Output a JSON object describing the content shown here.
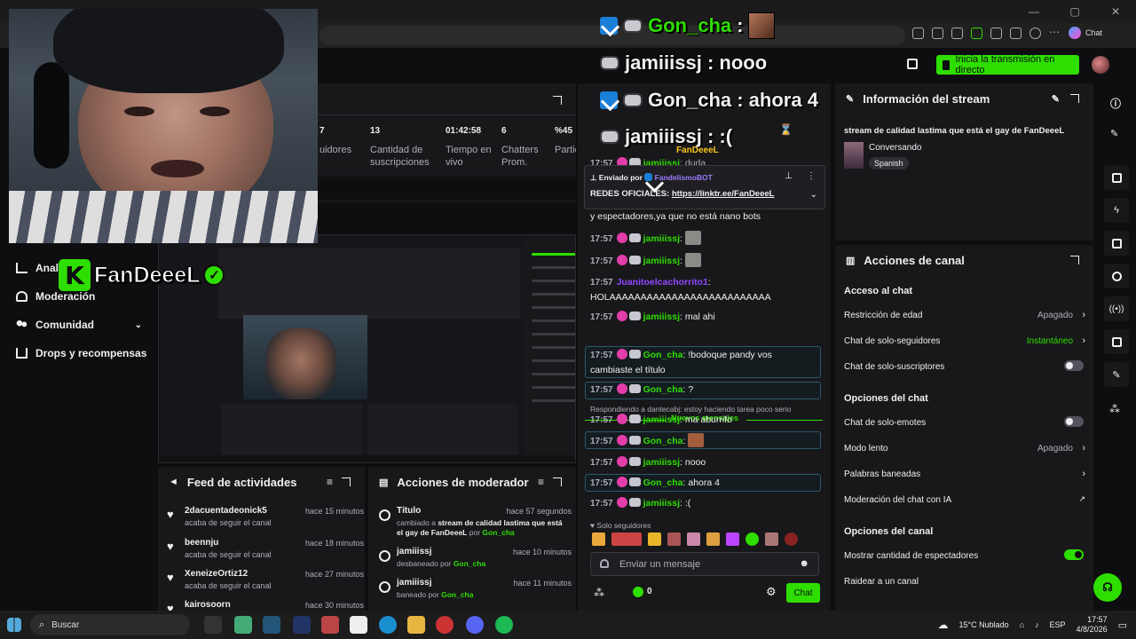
{
  "overlay": {
    "line1_user": "Gon_cha",
    "line1_sep": ":",
    "line2": "jamiiissj : nooo",
    "line3": "Gon_cha : ahora 4",
    "line4": "jamiiissj : :(",
    "line4_tag": "FanDeeeL"
  },
  "browser": {
    "chat_label": "Chat"
  },
  "topbar": {
    "go_live_label": "Inicia la transmisión en directo"
  },
  "nav": {
    "items": [
      {
        "label": "Anal"
      },
      {
        "label": "Moderación"
      },
      {
        "label": "Comunidad"
      },
      {
        "label": "Drops y recompensas"
      }
    ]
  },
  "logo": {
    "text": "FanDeeeL"
  },
  "stats": {
    "items": [
      {
        "value": "7",
        "label": "uidores"
      },
      {
        "value": "13",
        "label": "Cantidad de suscripciones"
      },
      {
        "value": "01:42:58",
        "label": "Tiempo en vivo"
      },
      {
        "value": "6",
        "label": "Chatters Prom."
      },
      {
        "value": "%45",
        "label": "Partic"
      }
    ]
  },
  "feed": {
    "title": "Feed de actividades",
    "rows": [
      {
        "name": "2dacuentadeonick5",
        "sub": "acaba de seguir el canal",
        "time": "hace 15 minutos"
      },
      {
        "name": "beennju",
        "sub": "acaba de seguir el canal",
        "time": "hace 18 minutos"
      },
      {
        "name": "XeneizeOrtiz12",
        "sub": "acaba de seguir el canal",
        "time": "hace 27 minutos"
      },
      {
        "name": "kairosoorn",
        "sub": "",
        "time": "hace 30 minutos"
      }
    ]
  },
  "modactions": {
    "title": "Acciones de moderador",
    "rows": [
      {
        "title": "Título",
        "sub_pre": "cambiado a ",
        "sub_bold": "stream de calidad lastima que está el gay de FanDeeeL",
        "sub_by": " por ",
        "sub_user": "Gon_cha",
        "time": "hace 57 segundos"
      },
      {
        "title": "jamiiissj",
        "sub_pre": "desbaneado por ",
        "sub_bold": "",
        "sub_by": "",
        "sub_user": "Gon_cha",
        "time": "hace 10 minutos"
      },
      {
        "title": "jamiiissj",
        "sub_pre": "baneado por ",
        "sub_bold": "",
        "sub_by": "",
        "sub_user": "Gon_cha",
        "time": "hace 11 minutos"
      }
    ]
  },
  "chat": {
    "pinned_by": "Enviado por",
    "pinned_user": "FandelismoBOT",
    "pinned_text": "REDES OFICIALES:",
    "pinned_link": "https://linktr.ee/FanDeeeL",
    "top_partial": "17:57",
    "top_partial_user": "jamiiissj",
    "top_partial_text": "duda",
    "cont_text": "y espectadores,ya que no está nano bots",
    "messages": [
      {
        "time": "17:57",
        "user": "jamiiissj",
        "text": ""
      },
      {
        "time": "17:57",
        "user": "jamiiissj",
        "text": ""
      },
      {
        "time": "17:57",
        "user": "Juanitoelcachorrito1",
        "text": "HOLAAAAAAAAAAAAAAAAAAAAAAAAAA"
      },
      {
        "time": "17:57",
        "user": "jamiiissj",
        "text": "mal ahi"
      }
    ],
    "new_label": "Nuevos mensajes",
    "new_messages": [
      {
        "time": "17:57",
        "user": "Gon_cha",
        "text": "!bodoque pandy vos cambiaste el título"
      },
      {
        "time": "17:57",
        "user": "Gon_cha",
        "text": "?"
      },
      {
        "time": "17:57",
        "user": "jamiiissj",
        "text": "ma aburrifo"
      },
      {
        "time": "17:57",
        "user": "Gon_cha",
        "text": ""
      },
      {
        "time": "17:57",
        "user": "jamiiissj",
        "text": "nooo"
      },
      {
        "time": "17:57",
        "user": "Gon_cha",
        "text": "ahora 4"
      },
      {
        "time": "17:57",
        "user": "jamiiissj",
        "text": ":("
      }
    ],
    "reply_note": "Respondiendo a dantecabj: estoy haciendo tarea poco serio",
    "followers_only": "Solo seguidores",
    "input_placeholder": "Enviar un mensaje",
    "points": "0",
    "send_label": "Chat"
  },
  "info": {
    "title": "Información del stream",
    "stream_title": "stream de calidad lastima que está el gay de FanDeeeL",
    "category": "Conversando",
    "language": "Spanish"
  },
  "actions": {
    "title": "Acciones de canal",
    "sec1": "Acceso al chat",
    "age": "Restricción de edad",
    "age_val": "Apagado",
    "followers": "Chat de solo-seguidores",
    "followers_val": "Instantáneo",
    "subs": "Chat de solo-suscriptores",
    "sec2": "Opciones del chat",
    "emotes": "Chat de solo-emotes",
    "slow": "Modo lento",
    "slow_val": "Apagado",
    "banned": "Palabras baneadas",
    "ai": "Moderación del chat con IA",
    "sec3": "Opciones del canal",
    "viewers": "Mostrar cantidad de espectadores",
    "raid": "Raidear a un canal"
  },
  "taskbar": {
    "search": "Buscar",
    "weather": "15°C  Nublado",
    "lang": "ESP",
    "time": "17:57",
    "date": "4/8/2026"
  },
  "colors": {
    "accent": "#2ede00",
    "bg": "#0e0e10",
    "panel": "#18181b",
    "purple": "#9147ff"
  }
}
